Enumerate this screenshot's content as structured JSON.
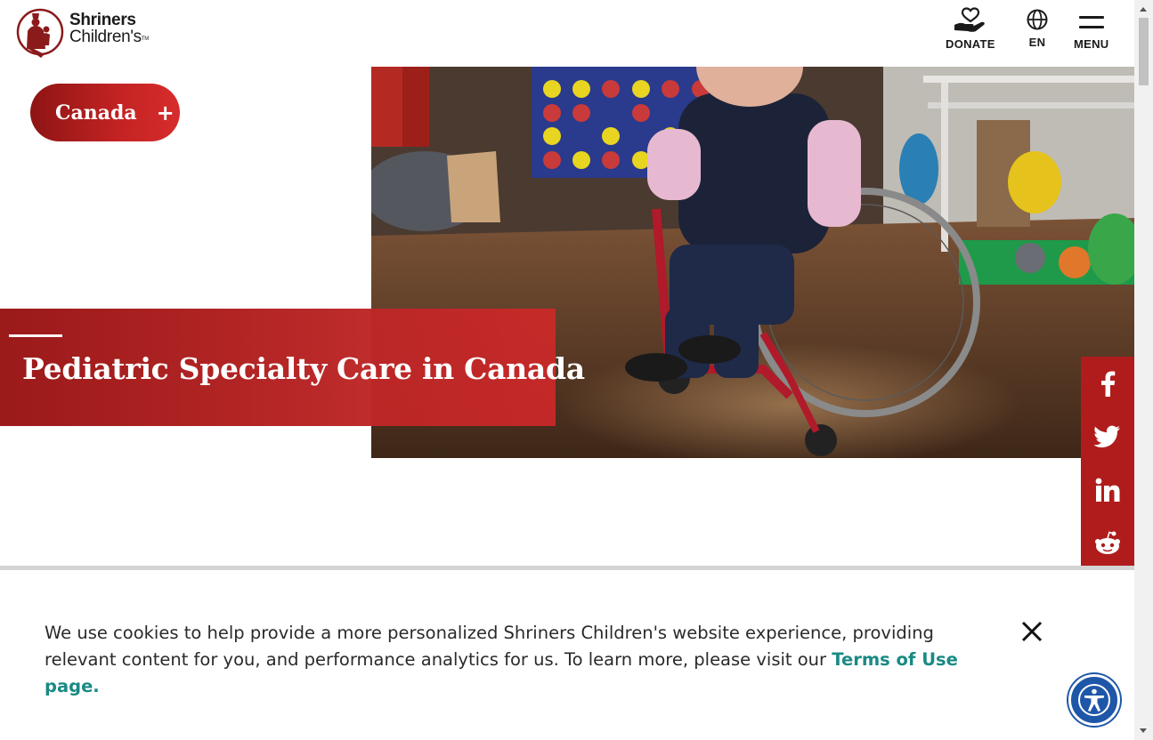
{
  "brand": {
    "line1": "Shriners",
    "line2": "Children's",
    "tm": "TM"
  },
  "topnav": {
    "donate": "DONATE",
    "language": "EN",
    "menu": "MENU"
  },
  "hero": {
    "region_button": {
      "label": "Canada",
      "toggle": "+"
    },
    "title": "Pediatric Specialty Care in Canada"
  },
  "social": [
    "facebook-icon",
    "twitter-icon",
    "linkedin-icon",
    "reddit-icon"
  ],
  "cookie": {
    "text": "We use cookies to help provide a more personalized Shriners Children's website experience, providing relevant content for you, and performance analytics for us. To learn more, please visit our ",
    "link": "Terms of Use page."
  },
  "colors": {
    "brand_red": "#b01c1c",
    "link_teal": "#1a8a84",
    "accessibility_blue": "#1f57a8"
  }
}
